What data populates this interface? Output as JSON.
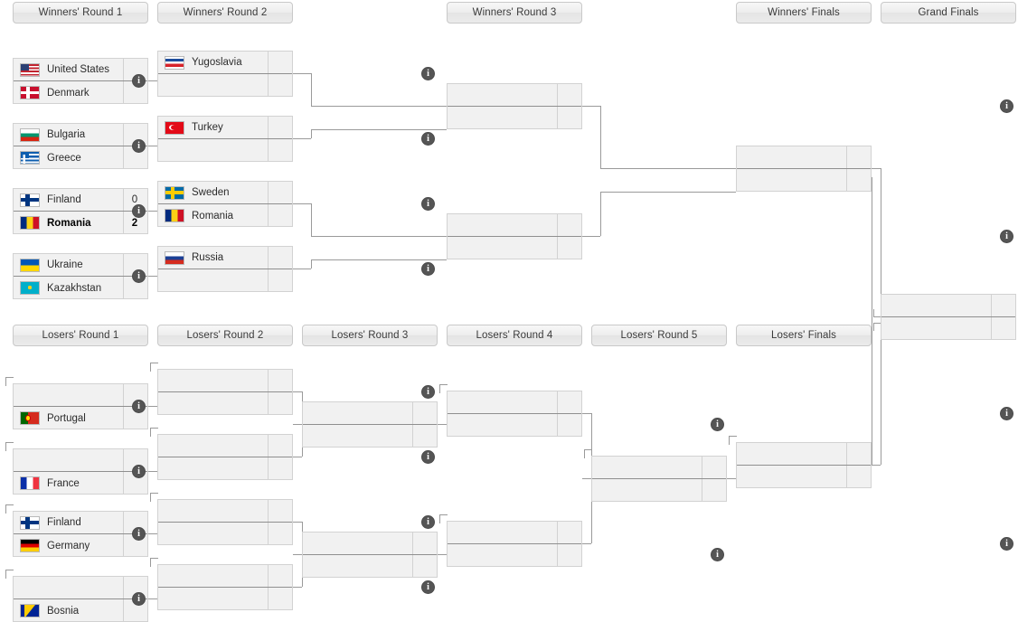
{
  "meta": {
    "title": "Double Elimination Tournament Bracket",
    "info_icon_glyph": "i",
    "info_icon_name": "info-icon",
    "colors": {
      "box_fill": "#f1f1f1",
      "box_border": "#d2d2d2",
      "line": "#9a9a9a",
      "header_text": "#3a3a3a",
      "info_badge": "#555555"
    }
  },
  "winners_headers": [
    {
      "label": "Winners' Round 1"
    },
    {
      "label": "Winners' Round 2"
    },
    {
      "label": "Winners' Round 3"
    },
    {
      "label": "Winners' Finals"
    },
    {
      "label": "Grand Finals"
    }
  ],
  "losers_headers": [
    {
      "label": "Losers' Round 1"
    },
    {
      "label": "Losers' Round 2"
    },
    {
      "label": "Losers' Round 3"
    },
    {
      "label": "Losers' Round 4"
    },
    {
      "label": "Losers' Round 5"
    },
    {
      "label": "Losers' Finals"
    }
  ],
  "matches": {
    "wr1_m1": {
      "top": {
        "team": "United States",
        "flag": "us",
        "score": "",
        "winner": false
      },
      "bottom": {
        "team": "Denmark",
        "flag": "dk",
        "score": "",
        "winner": false
      }
    },
    "wr1_m2": {
      "top": {
        "team": "Bulgaria",
        "flag": "bg",
        "score": "",
        "winner": false
      },
      "bottom": {
        "team": "Greece",
        "flag": "gr",
        "score": "",
        "winner": false
      }
    },
    "wr1_m3": {
      "top": {
        "team": "Finland",
        "flag": "fi",
        "score": "0",
        "winner": false
      },
      "bottom": {
        "team": "Romania",
        "flag": "ro",
        "score": "2",
        "winner": true
      }
    },
    "wr1_m4": {
      "top": {
        "team": "Ukraine",
        "flag": "ua",
        "score": "",
        "winner": false
      },
      "bottom": {
        "team": "Kazakhstan",
        "flag": "kz",
        "score": "",
        "winner": false
      }
    },
    "wr2_m1": {
      "top": {
        "team": "Yugoslavia",
        "flag": "yu",
        "score": "",
        "winner": false
      },
      "bottom": {
        "team": "",
        "flag": "",
        "score": "",
        "winner": false
      }
    },
    "wr2_m2": {
      "top": {
        "team": "Turkey",
        "flag": "tr",
        "score": "",
        "winner": false
      },
      "bottom": {
        "team": "",
        "flag": "",
        "score": "",
        "winner": false
      }
    },
    "wr2_m3": {
      "top": {
        "team": "Sweden",
        "flag": "se",
        "score": "",
        "winner": false
      },
      "bottom": {
        "team": "Romania",
        "flag": "ro",
        "score": "",
        "winner": false
      }
    },
    "wr2_m4": {
      "top": {
        "team": "Russia",
        "flag": "ru",
        "score": "",
        "winner": false
      },
      "bottom": {
        "team": "",
        "flag": "",
        "score": "",
        "winner": false
      }
    },
    "wr3_m1": {
      "top": {
        "team": "",
        "flag": "",
        "score": "",
        "winner": false
      },
      "bottom": {
        "team": "",
        "flag": "",
        "score": "",
        "winner": false
      }
    },
    "wr3_m2": {
      "top": {
        "team": "",
        "flag": "",
        "score": "",
        "winner": false
      },
      "bottom": {
        "team": "",
        "flag": "",
        "score": "",
        "winner": false
      }
    },
    "wf_m1": {
      "top": {
        "team": "",
        "flag": "",
        "score": "",
        "winner": false
      },
      "bottom": {
        "team": "",
        "flag": "",
        "score": "",
        "winner": false
      }
    },
    "gf_m1": {
      "top": {
        "team": "",
        "flag": "",
        "score": "",
        "winner": false
      },
      "bottom": {
        "team": "",
        "flag": "",
        "score": "",
        "winner": false
      }
    },
    "lr1_m1": {
      "top": {
        "team": "",
        "flag": "",
        "score": "",
        "winner": false
      },
      "bottom": {
        "team": "Portugal",
        "flag": "pt",
        "score": "",
        "winner": false
      }
    },
    "lr1_m2": {
      "top": {
        "team": "",
        "flag": "",
        "score": "",
        "winner": false
      },
      "bottom": {
        "team": "France",
        "flag": "fr",
        "score": "",
        "winner": false
      }
    },
    "lr1_m3": {
      "top": {
        "team": "Finland",
        "flag": "fi",
        "score": "",
        "winner": false
      },
      "bottom": {
        "team": "Germany",
        "flag": "de",
        "score": "",
        "winner": false
      }
    },
    "lr1_m4": {
      "top": {
        "team": "",
        "flag": "",
        "score": "",
        "winner": false
      },
      "bottom": {
        "team": "Bosnia",
        "flag": "ba",
        "score": "",
        "winner": false
      }
    },
    "lr2_m1": {
      "top": {
        "team": "",
        "flag": "",
        "score": "",
        "winner": false
      },
      "bottom": {
        "team": "",
        "flag": "",
        "score": "",
        "winner": false
      }
    },
    "lr2_m2": {
      "top": {
        "team": "",
        "flag": "",
        "score": "",
        "winner": false
      },
      "bottom": {
        "team": "",
        "flag": "",
        "score": "",
        "winner": false
      }
    },
    "lr2_m3": {
      "top": {
        "team": "",
        "flag": "",
        "score": "",
        "winner": false
      },
      "bottom": {
        "team": "",
        "flag": "",
        "score": "",
        "winner": false
      }
    },
    "lr2_m4": {
      "top": {
        "team": "",
        "flag": "",
        "score": "",
        "winner": false
      },
      "bottom": {
        "team": "",
        "flag": "",
        "score": "",
        "winner": false
      }
    },
    "lr3_m1": {
      "top": {
        "team": "",
        "flag": "",
        "score": "",
        "winner": false
      },
      "bottom": {
        "team": "",
        "flag": "",
        "score": "",
        "winner": false
      }
    },
    "lr3_m2": {
      "top": {
        "team": "",
        "flag": "",
        "score": "",
        "winner": false
      },
      "bottom": {
        "team": "",
        "flag": "",
        "score": "",
        "winner": false
      }
    },
    "lr4_m1": {
      "top": {
        "team": "",
        "flag": "",
        "score": "",
        "winner": false
      },
      "bottom": {
        "team": "",
        "flag": "",
        "score": "",
        "winner": false
      }
    },
    "lr4_m2": {
      "top": {
        "team": "",
        "flag": "",
        "score": "",
        "winner": false
      },
      "bottom": {
        "team": "",
        "flag": "",
        "score": "",
        "winner": false
      }
    },
    "lr5_m1": {
      "top": {
        "team": "",
        "flag": "",
        "score": "",
        "winner": false
      },
      "bottom": {
        "team": "",
        "flag": "",
        "score": "",
        "winner": false
      }
    },
    "lf_m1": {
      "top": {
        "team": "",
        "flag": "",
        "score": "",
        "winner": false
      },
      "bottom": {
        "team": "",
        "flag": "",
        "score": "",
        "winner": false
      }
    }
  }
}
